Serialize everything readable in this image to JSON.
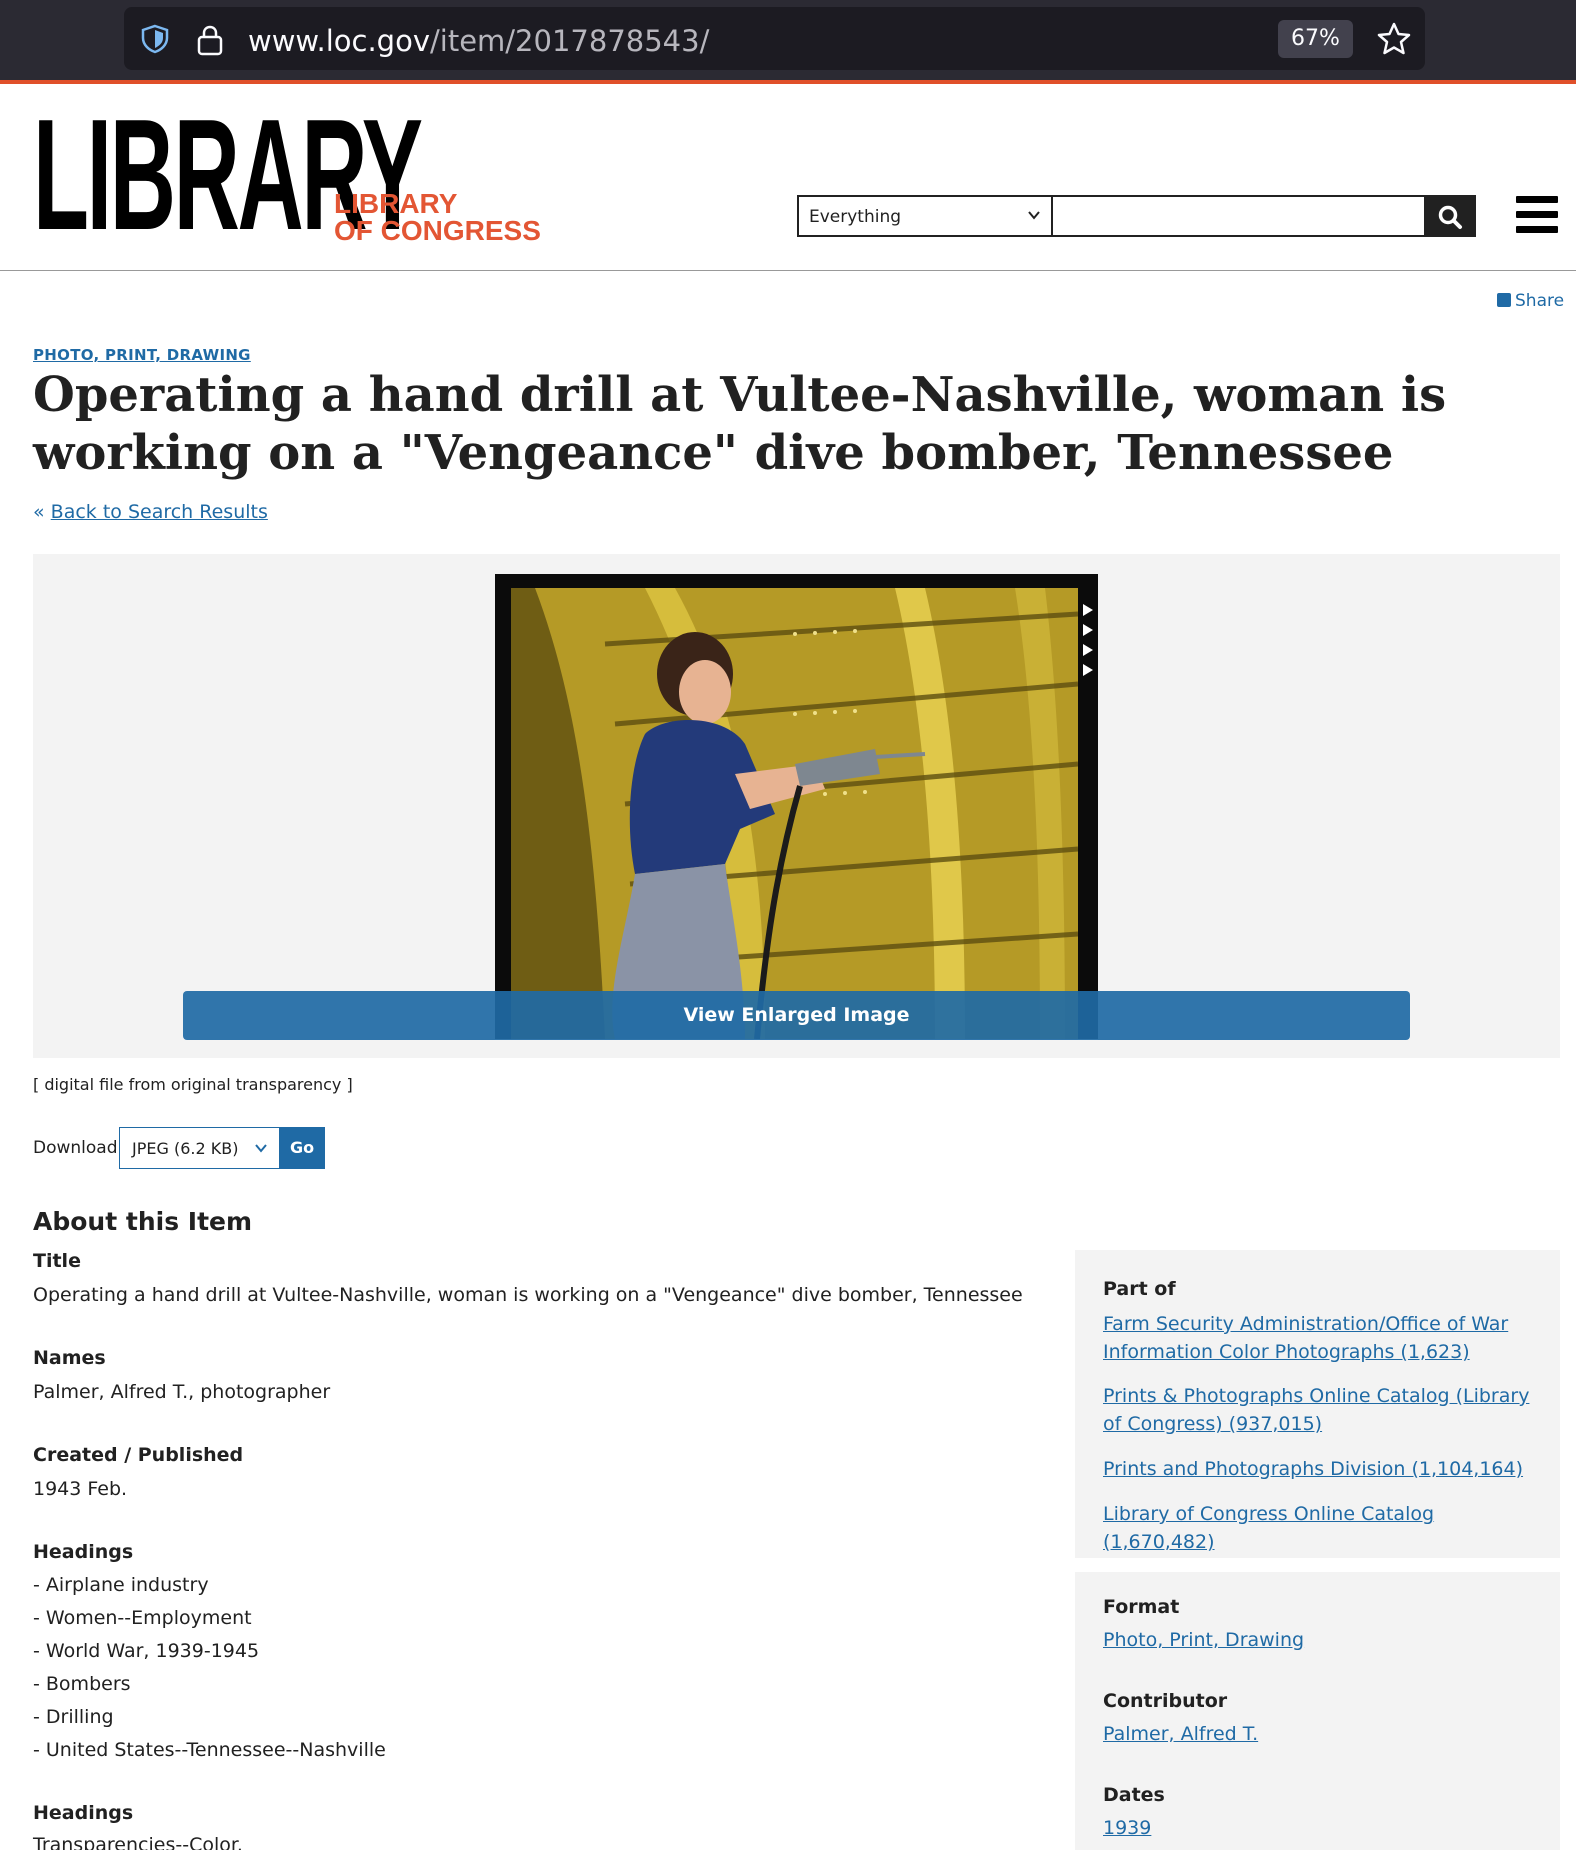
{
  "browser": {
    "url_domain": "www.loc.gov",
    "url_path": "/item/2017878543/",
    "zoom": "67%"
  },
  "header": {
    "logo_text": "LIBRARY",
    "logo_subtext_1": "LIBRARY",
    "logo_subtext_2": "OF CONGRESS",
    "search_scope": "Everything",
    "search_placeholder": "",
    "share_label": "Share"
  },
  "item": {
    "category": "PHOTO, PRINT, DRAWING",
    "title": "Operating a hand drill at Vultee-Nashville, woman is working on a \"Vengeance\" dive bomber, Tennessee",
    "back_link": "Back to Search Results",
    "enlarge_label": "View Enlarged Image",
    "caption": "[ digital file from original transparency ]",
    "download_label": "Download:",
    "download_option": "JPEG (6.2 KB)",
    "download_go": "Go"
  },
  "about": {
    "heading": "About this Item",
    "title_label": "Title",
    "title_value": "Operating a hand drill at Vultee-Nashville, woman is working on a \"Vengeance\" dive bomber, Tennessee",
    "names_label": "Names",
    "names_value": "Palmer, Alfred T., photographer",
    "created_label": "Created / Published",
    "created_value": "1943 Feb.",
    "headings_label": "Headings",
    "headings": [
      "-  Airplane industry",
      "-  Women--Employment",
      "-  World War, 1939-1945",
      "-  Bombers",
      "-  Drilling",
      "-  United States--Tennessee--Nashville"
    ],
    "headings2_label": "Headings",
    "headings2_first": "Transparencies--Color."
  },
  "sidebar": {
    "part_of_label": "Part of",
    "part_of_links": [
      "Farm Security Administration/Office of War Information Color Photographs (1,623)",
      "Prints & Photographs Online Catalog (Library of Congress) (937,015)",
      "Prints and Photographs Division (1,104,164)",
      "Library of Congress Online Catalog (1,670,482)"
    ],
    "format_label": "Format",
    "format_value": "Photo, Print, Drawing",
    "contributor_label": "Contributor",
    "contributor_value": "Palmer, Alfred T.",
    "dates_label": "Dates",
    "dates_value": "1939"
  },
  "colors": {
    "link": "#1f6aa5",
    "brand_orange": "#e35634",
    "chrome": "#2b2a33"
  }
}
